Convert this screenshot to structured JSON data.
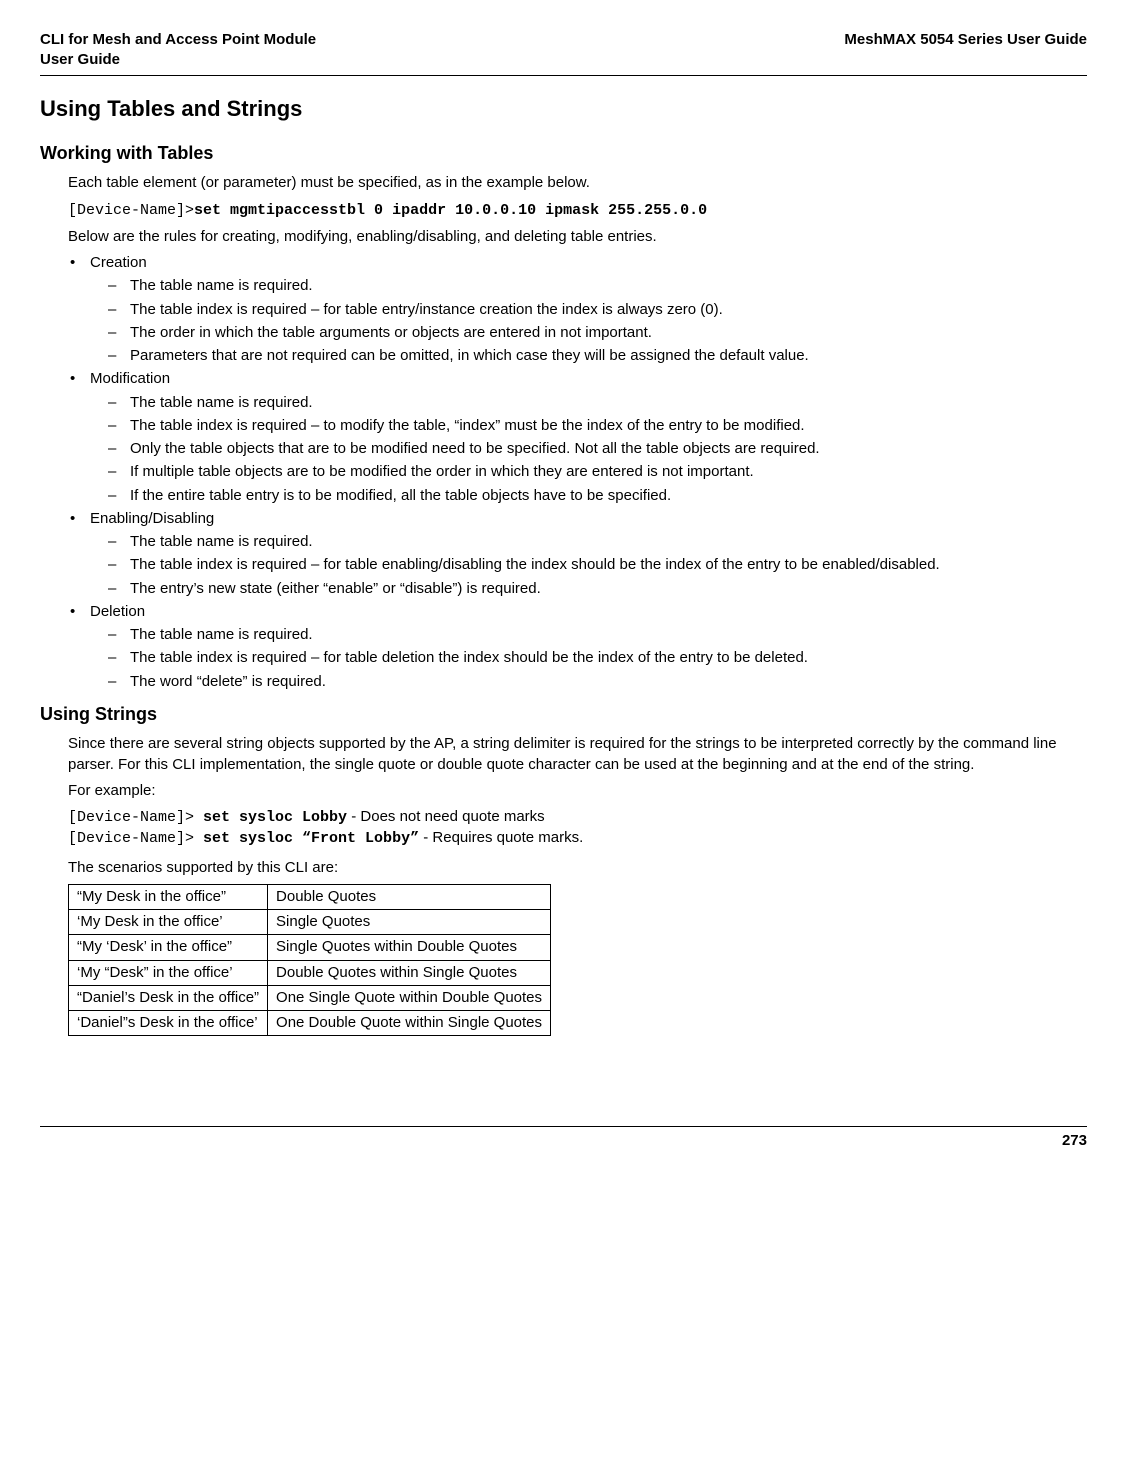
{
  "header": {
    "left": "CLI for Mesh and Access Point Module\n User Guide",
    "right": "MeshMAX 5054 Series User Guide"
  },
  "h1": "Using Tables and Strings",
  "section1": {
    "title": "Working with Tables",
    "intro": "Each table element (or parameter) must be specified, as in the example below.",
    "cmd_prompt": "[Device-Name]>",
    "cmd_text": "set mgmtipaccesstbl 0 ipaddr 10.0.0.10 ipmask 255.255.0.0",
    "rules_intro": "Below are the rules for creating, modifying, enabling/disabling, and deleting table entries.",
    "groups": [
      {
        "label": "Creation",
        "items": [
          "The table name is required.",
          "The table index is required – for table entry/instance creation the index is always zero (0).",
          "The order in which the table arguments or objects are entered in not important.",
          "Parameters that are not required can be omitted, in which case they will be assigned the default value."
        ]
      },
      {
        "label": "Modification",
        "items": [
          "The table name is required.",
          "The table index is required – to modify the table, “index” must be the index of the entry to be modified.",
          "Only the table objects that are to be modified need to be specified. Not all the table objects are required.",
          "If multiple table objects are to be modified the order in which they are entered is not important.",
          "If the entire table entry is to be modified, all the table objects have to be specified."
        ]
      },
      {
        "label": "Enabling/Disabling",
        "items": [
          "The table name is required.",
          "The table index is required – for table enabling/disabling the index should be the index of the entry to be enabled/disabled.",
          "The entry’s new state (either “enable” or “disable”) is required."
        ]
      },
      {
        "label": "Deletion",
        "items": [
          "The table name is required.",
          "The table index is required – for table deletion the index should be the index of the entry to be deleted.",
          "The word “delete” is required."
        ]
      }
    ]
  },
  "section2": {
    "title": "Using Strings",
    "intro": "Since there are several string objects supported by the AP, a string delimiter is required for the strings to be interpreted correctly by the command line parser. For this CLI implementation, the single quote or double quote character can be used at the beginning and at the end of the string.",
    "for_example": "For example:",
    "ex1_prompt": "[Device-Name]>",
    "ex1_cmd": " set sysloc Lobby",
    "ex1_note": " - Does not need quote marks",
    "ex2_prompt": "[Device-Name]>",
    "ex2_cmd": " set sysloc “Front Lobby”",
    "ex2_note": " - Requires quote marks.",
    "scenarios_intro": "The scenarios supported by this CLI are:",
    "table": [
      [
        "“My Desk in the office”",
        "Double Quotes"
      ],
      [
        "‘My Desk in the office’",
        "Single Quotes"
      ],
      [
        "“My ‘Desk’ in the office”",
        "Single Quotes within Double Quotes"
      ],
      [
        "‘My “Desk” in the office’",
        "Double Quotes within Single Quotes"
      ],
      [
        "“Daniel’s Desk in the office”",
        "One Single Quote within Double Quotes"
      ],
      [
        "‘Daniel”s Desk in the office’",
        "One Double Quote within Single Quotes"
      ]
    ]
  },
  "footer": {
    "page": "273"
  }
}
